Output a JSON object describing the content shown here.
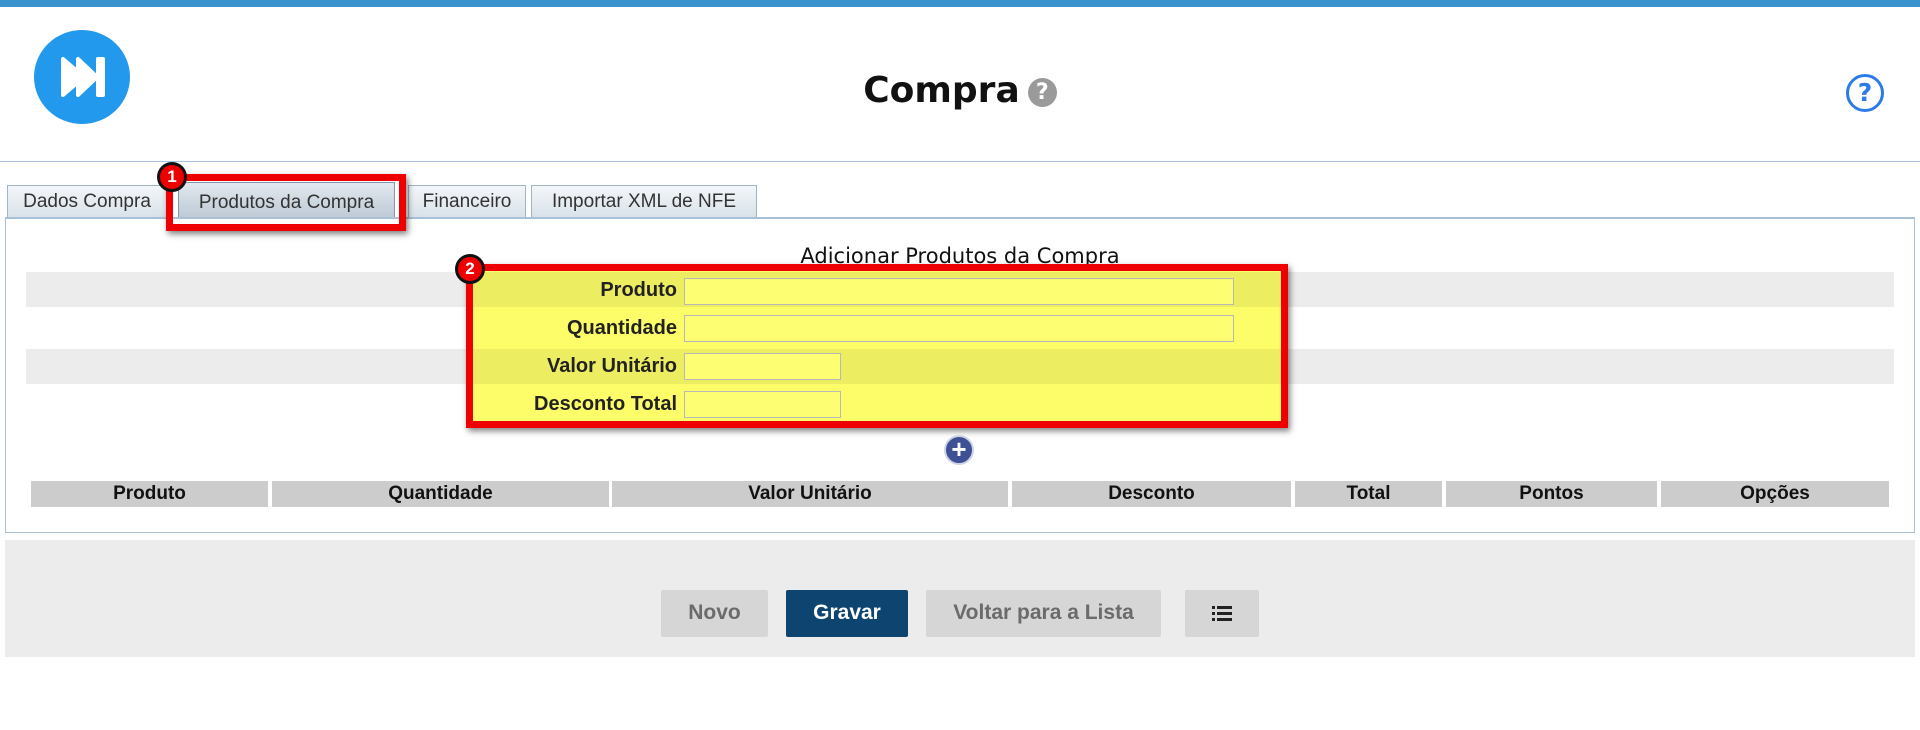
{
  "page": {
    "title": "Compra"
  },
  "tabs": [
    {
      "label": "Dados Compra"
    },
    {
      "label": "Produtos da Compra"
    },
    {
      "label": "Financeiro"
    },
    {
      "label": "Importar XML de NFE"
    }
  ],
  "callouts": {
    "tab_badge": "1",
    "form_badge": "2"
  },
  "form": {
    "title": "Adicionar Produtos da Compra",
    "fields": [
      {
        "label": "Produto",
        "value": ""
      },
      {
        "label": "Quantidade",
        "value": ""
      },
      {
        "label": "Valor Unitário",
        "value": ""
      },
      {
        "label": "Desconto Total",
        "value": ""
      }
    ]
  },
  "table": {
    "headers": [
      "Produto",
      "Quantidade",
      "Valor Unitário",
      "Desconto",
      "Total",
      "Pontos",
      "Opções"
    ]
  },
  "footer": {
    "buttons": {
      "novo": "Novo",
      "gravar": "Gravar",
      "voltar": "Voltar para a Lista"
    }
  },
  "icons": {
    "logo": "fast-forward-icon",
    "title_help": "question-circle-icon",
    "help": "help-circle-icon",
    "add": "plus-circle-icon",
    "list": "list-icon"
  },
  "colors": {
    "accent": "#3a93cf",
    "logo": "#2299ec",
    "primary_button": "#0e4470",
    "highlight_red": "#ee0000",
    "highlight_yellow": "#fdfd6a"
  }
}
